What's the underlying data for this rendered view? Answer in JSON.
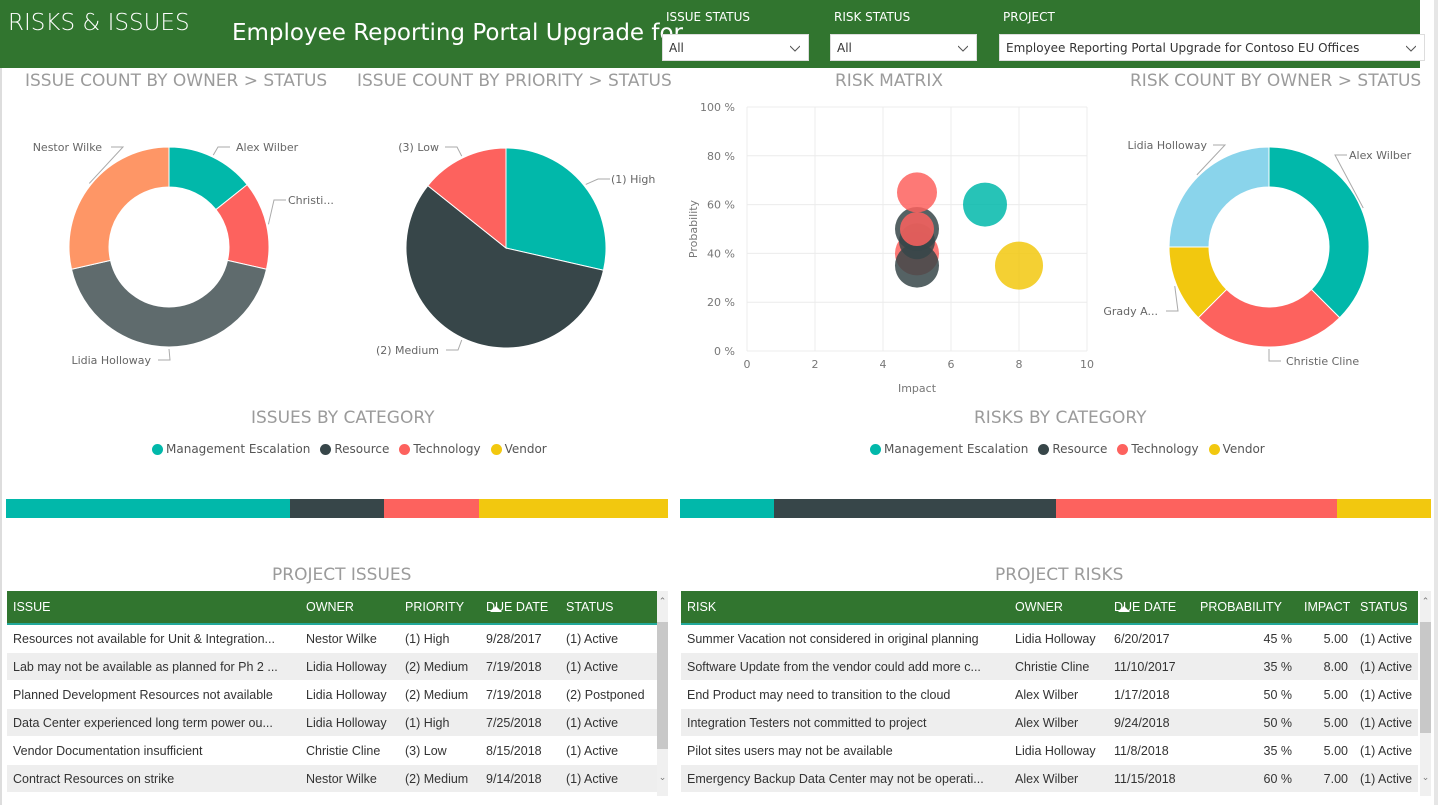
{
  "header": {
    "app_title": "RISKS & ISSUES",
    "project_title": "Employee Reporting Portal Upgrade for...",
    "filters": [
      {
        "label": "ISSUE STATUS",
        "value": "All"
      },
      {
        "label": "RISK STATUS",
        "value": "All"
      },
      {
        "label": "PROJECT",
        "value": "Employee Reporting Portal Upgrade for Contoso EU Offices"
      }
    ]
  },
  "colors": {
    "brand_green": "#31752f",
    "teal": "#01b8aa",
    "dark": "#374649",
    "coral": "#fd625e",
    "yellow": "#f2c80f",
    "gray": "#5f6b6d",
    "orange": "#fe9666",
    "light_blue": "#8ad4eb"
  },
  "visuals": {
    "issue_owner_title": "ISSUE COUNT BY OWNER > STATUS",
    "issue_priority_title": "ISSUE COUNT BY PRIORITY > STATUS",
    "risk_matrix_title": "RISK MATRIX",
    "risk_owner_title": "RISK COUNT BY OWNER > STATUS",
    "issues_category_title": "ISSUES BY CATEGORY",
    "risks_category_title": "RISKS BY CATEGORY",
    "project_issues_title": "PROJECT ISSUES",
    "project_risks_title": "PROJECT RISKS"
  },
  "chart_data": [
    {
      "id": "issue_owner",
      "type": "pie",
      "variant": "donut",
      "title": "ISSUE COUNT BY OWNER > STATUS",
      "slices": [
        {
          "label": "Alex Wilber",
          "value": 1,
          "color": "#01b8aa"
        },
        {
          "label": "Christi...",
          "value": 1,
          "color": "#fd625e"
        },
        {
          "label": "Lidia Holloway",
          "value": 3,
          "color": "#5f6b6d"
        },
        {
          "label": "Nestor Wilke",
          "value": 2,
          "color": "#fe9666"
        }
      ]
    },
    {
      "id": "issue_priority",
      "type": "pie",
      "title": "ISSUE COUNT BY PRIORITY > STATUS",
      "slices": [
        {
          "label": "(1) High",
          "value": 2,
          "color": "#01b8aa"
        },
        {
          "label": "(2) Medium",
          "value": 4,
          "color": "#374649"
        },
        {
          "label": "(3) Low",
          "value": 1,
          "color": "#fd625e"
        }
      ]
    },
    {
      "id": "risk_matrix",
      "type": "scatter",
      "title": "RISK MATRIX",
      "xlabel": "Impact",
      "ylabel": "Probability",
      "xlim": [
        0,
        10
      ],
      "ylim": [
        0,
        100
      ],
      "xticks": [
        "0",
        "2",
        "4",
        "6",
        "8",
        "10"
      ],
      "yticks": [
        "0 %",
        "20 %",
        "40 %",
        "60 %",
        "80 %",
        "100 %"
      ],
      "grid": true,
      "points": [
        {
          "x": 5,
          "y": 40,
          "category": "Technology",
          "color": "#fd625e"
        },
        {
          "x": 5,
          "y": 35,
          "category": "Resource",
          "color": "#374649"
        },
        {
          "x": 5,
          "y": 50,
          "category": "Resource",
          "color": "#374649"
        },
        {
          "x": 5,
          "y": 45,
          "category": "Resource",
          "color": "#374649"
        },
        {
          "x": 5,
          "y": 65,
          "category": "Technology",
          "color": "#fd625e"
        },
        {
          "x": 5,
          "y": 50,
          "category": "Technology",
          "color": "#fd625e"
        },
        {
          "x": 7,
          "y": 60,
          "category": "Management Escalation",
          "color": "#01b8aa"
        },
        {
          "x": 8,
          "y": 35,
          "category": "Vendor",
          "color": "#f2c80f"
        }
      ]
    },
    {
      "id": "risk_owner",
      "type": "pie",
      "variant": "donut",
      "title": "RISK COUNT BY OWNER > STATUS",
      "slices": [
        {
          "label": "Alex Wilber",
          "value": 3,
          "color": "#01b8aa"
        },
        {
          "label": "Christie Cline",
          "value": 2,
          "color": "#fd625e"
        },
        {
          "label": "Grady A...",
          "value": 1,
          "color": "#f2c80f"
        },
        {
          "label": "Lidia Holloway",
          "value": 2,
          "color": "#8ad4eb"
        }
      ]
    },
    {
      "id": "issues_category",
      "type": "bar",
      "variant": "100% stacked",
      "title": "ISSUES BY CATEGORY",
      "legend": "top",
      "series": [
        {
          "name": "Management Escalation",
          "value": 3,
          "color": "#01b8aa"
        },
        {
          "name": "Resource",
          "value": 1,
          "color": "#374649"
        },
        {
          "name": "Technology",
          "value": 1,
          "color": "#fd625e"
        },
        {
          "name": "Vendor",
          "value": 2,
          "color": "#f2c80f"
        }
      ]
    },
    {
      "id": "risks_category",
      "type": "bar",
      "variant": "100% stacked",
      "title": "RISKS BY CATEGORY",
      "legend": "top",
      "series": [
        {
          "name": "Management Escalation",
          "value": 1,
          "color": "#01b8aa"
        },
        {
          "name": "Resource",
          "value": 3,
          "color": "#374649"
        },
        {
          "name": "Technology",
          "value": 3,
          "color": "#fd625e"
        },
        {
          "name": "Vendor",
          "value": 1,
          "color": "#f2c80f"
        }
      ]
    }
  ],
  "issues_table": {
    "columns": [
      "ISSUE",
      "OWNER",
      "PRIORITY",
      "DUE DATE",
      "STATUS"
    ],
    "sorted_column": "DUE DATE",
    "rows": [
      [
        "Resources not available for Unit & Integration...",
        "Nestor Wilke",
        "(1) High",
        "9/28/2017",
        "(1) Active"
      ],
      [
        "Lab may not be available as planned for Ph 2 ...",
        "Lidia Holloway",
        "(2) Medium",
        "7/19/2018",
        "(1) Active"
      ],
      [
        "Planned Development Resources not available",
        "Lidia Holloway",
        "(2) Medium",
        "7/19/2018",
        "(2) Postponed"
      ],
      [
        "Data Center experienced long term power ou...",
        "Lidia Holloway",
        "(1) High",
        "7/25/2018",
        "(1) Active"
      ],
      [
        "Vendor Documentation insufficient",
        "Christie Cline",
        "(3) Low",
        "8/15/2018",
        "(1) Active"
      ],
      [
        "Contract Resources on strike",
        "Nestor Wilke",
        "(2) Medium",
        "9/14/2018",
        "(1) Active"
      ]
    ]
  },
  "risks_table": {
    "columns": [
      "RISK",
      "OWNER",
      "DUE DATE",
      "PROBABILITY",
      "IMPACT",
      "STATUS"
    ],
    "sorted_column": "DUE DATE",
    "rows": [
      [
        "Summer Vacation not considered in original planning",
        "Lidia Holloway",
        "6/20/2017",
        "45 %",
        "5.00",
        "(1) Active"
      ],
      [
        "Software Update from the vendor could add more c...",
        "Christie Cline",
        "11/10/2017",
        "35 %",
        "8.00",
        "(1) Active"
      ],
      [
        "End Product may need to transition to the cloud",
        "Alex Wilber",
        "1/17/2018",
        "50 %",
        "5.00",
        "(1) Active"
      ],
      [
        "Integration Testers not committed to project",
        "Alex Wilber",
        "9/24/2018",
        "50 %",
        "5.00",
        "(1) Active"
      ],
      [
        "Pilot sites users may not be available",
        "Lidia Holloway",
        "11/8/2018",
        "35 %",
        "5.00",
        "(1) Active"
      ],
      [
        "Emergency Backup Data Center may not be operati...",
        "Alex Wilber",
        "11/15/2018",
        "60 %",
        "7.00",
        "(1) Active"
      ]
    ]
  }
}
